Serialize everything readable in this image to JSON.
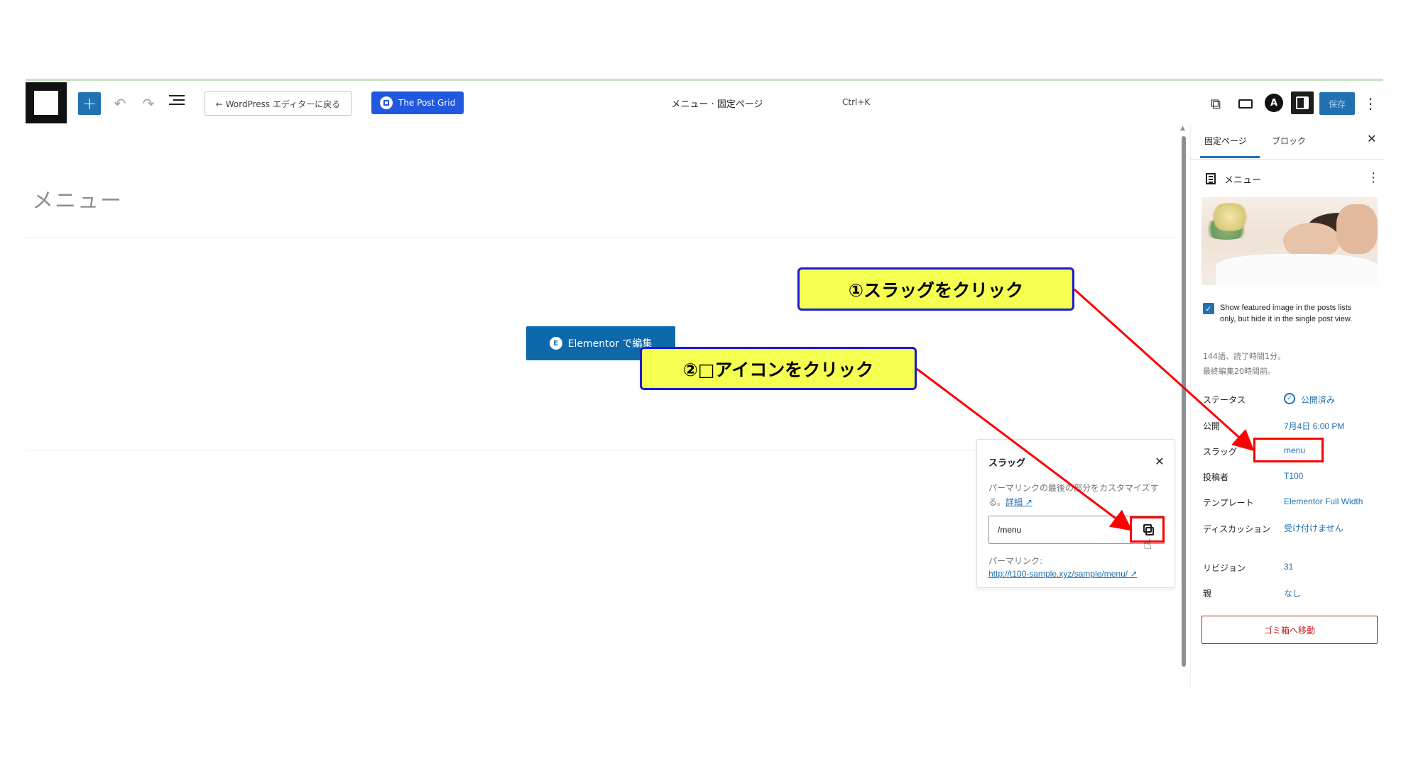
{
  "toolbar": {
    "back_label": "← WordPress エディターに戻る",
    "postgrid_label": "The Post Grid",
    "doc_title": "メニュー · 固定ページ",
    "shortcut": "Ctrl+K",
    "astra_letter": "A",
    "save_label": "保存",
    "add_label": "+",
    "undo_label": "↶",
    "redo_label": "↷",
    "external_label": "⧉",
    "more_label": "⋮"
  },
  "editor": {
    "page_title": "メニュー",
    "elementor_button": "Elementor で編集",
    "elementor_icon_letter": "E"
  },
  "slug_popover": {
    "title": "スラッグ",
    "close": "✕",
    "description": "パーマリンクの最後の部分をカスタマイズする。",
    "more_link": "詳細 ↗",
    "slug_value": "/menu",
    "permalink_label": "パーマリンク:",
    "permalink_url": "http://t100-sample.xyz/sample/menu/ ↗"
  },
  "sidebar": {
    "tabs": [
      "固定ページ",
      "ブロック"
    ],
    "close": "✕",
    "page_name": "メニュー",
    "more": "⋮",
    "featured_checkbox_label": "Show featured image in the posts lists only, but hide it in the single post view.",
    "checkbox_checked": true,
    "word_count": "144語、読了時間1分。",
    "last_edited": "最終編集20時間前。",
    "rows": [
      {
        "label": "ステータス",
        "value": "公開済み"
      },
      {
        "label": "公開",
        "value": "7月4日 6:00 PM"
      },
      {
        "label": "スラッグ",
        "value": "menu"
      },
      {
        "label": "投稿者",
        "value": "T100"
      },
      {
        "label": "テンプレート",
        "value": "Elementor Full Width"
      },
      {
        "label": "ディスカッション",
        "value": "受け付けません"
      },
      {
        "label": "リビジョン",
        "value": "31"
      },
      {
        "label": "親",
        "value": "なし"
      }
    ],
    "trash_label": "ゴミ箱へ移動"
  },
  "annotations": {
    "callout1": "①スラッグをクリック",
    "callout2": "②□アイコンをクリック",
    "arrow_color": "#ff0000",
    "callout_bg": "#f5ff50",
    "callout_border": "#1a1ad6"
  },
  "colors": {
    "accent": "#2271b1",
    "elementor": "#0e69ab",
    "postgrid": "#2158e0",
    "danger": "#cc1818"
  }
}
